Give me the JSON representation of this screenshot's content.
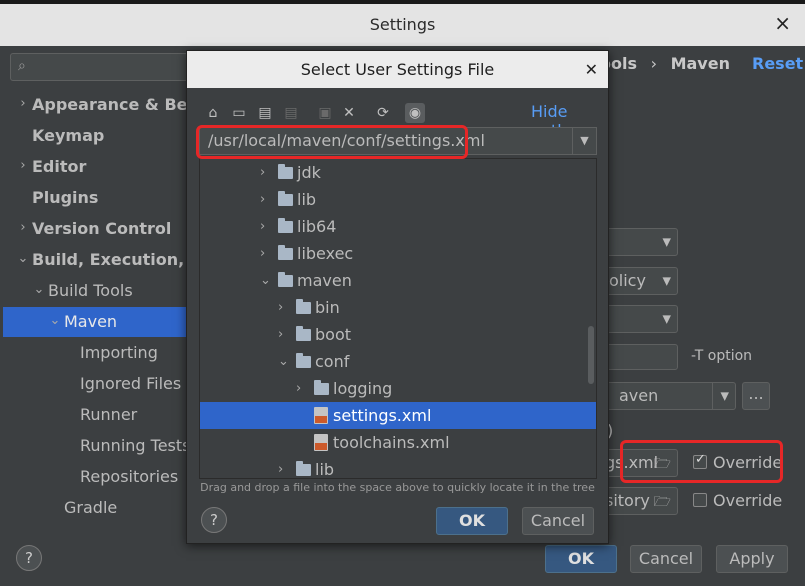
{
  "window": {
    "title": "Settings"
  },
  "sidebar": {
    "items": [
      {
        "label": "Appearance & Behavior",
        "bold": true,
        "arrow": "›"
      },
      {
        "label": "Keymap",
        "bold": true,
        "arrow": ""
      },
      {
        "label": "Editor",
        "bold": true,
        "arrow": "›"
      },
      {
        "label": "Plugins",
        "bold": true,
        "arrow": ""
      },
      {
        "label": "Version Control",
        "bold": true,
        "arrow": "›"
      },
      {
        "label": "Build, Execution, Deployment",
        "bold": true,
        "arrow": "⌄"
      },
      {
        "label": "Build Tools",
        "bold": false,
        "arrow": "⌄"
      },
      {
        "label": "Maven",
        "bold": false,
        "arrow": "⌄"
      },
      {
        "label": "Importing",
        "bold": false,
        "arrow": ""
      },
      {
        "label": "Ignored Files",
        "bold": false,
        "arrow": ""
      },
      {
        "label": "Runner",
        "bold": false,
        "arrow": ""
      },
      {
        "label": "Running Tests",
        "bold": false,
        "arrow": ""
      },
      {
        "label": "Repositories",
        "bold": false,
        "arrow": ""
      },
      {
        "label": "Gradle",
        "bold": false,
        "arrow": ""
      }
    ]
  },
  "breadcrumb": {
    "part1": "ools",
    "sep": "›",
    "part2": "Maven",
    "reset": "Reset"
  },
  "right": {
    "policy_fragment": "olicy",
    "t_option": "-T option",
    "maven_home_fragment": "aven",
    "more_button": "...",
    "settings_file_fragment": "gs.xml",
    "local_repo_fragment": "sitory",
    "override1": "Override",
    "override2": "Override",
    "paren_fragment": ")"
  },
  "dialog": {
    "title": "Select User Settings File",
    "hide_path": "Hide path",
    "path": "/usr/local/maven/conf/settings.xml",
    "tree": [
      {
        "label": "jdk",
        "type": "folder",
        "depth": 0,
        "arrow": "›"
      },
      {
        "label": "lib",
        "type": "folder",
        "depth": 0,
        "arrow": "›"
      },
      {
        "label": "lib64",
        "type": "folder",
        "depth": 0,
        "arrow": "›"
      },
      {
        "label": "libexec",
        "type": "folder",
        "depth": 0,
        "arrow": "›"
      },
      {
        "label": "maven",
        "type": "folder",
        "depth": 0,
        "arrow": "⌄"
      },
      {
        "label": "bin",
        "type": "folder",
        "depth": 1,
        "arrow": "›"
      },
      {
        "label": "boot",
        "type": "folder",
        "depth": 1,
        "arrow": "›"
      },
      {
        "label": "conf",
        "type": "folder",
        "depth": 1,
        "arrow": "⌄"
      },
      {
        "label": "logging",
        "type": "folder",
        "depth": 2,
        "arrow": "›"
      },
      {
        "label": "settings.xml",
        "type": "xml",
        "depth": 2,
        "arrow": ""
      },
      {
        "label": "toolchains.xml",
        "type": "xml",
        "depth": 2,
        "arrow": ""
      },
      {
        "label": "lib",
        "type": "folder",
        "depth": 1,
        "arrow": "›"
      }
    ],
    "hint": "Drag and drop a file into the space above to quickly locate it in the tree",
    "ok": "OK",
    "cancel": "Cancel"
  },
  "footer": {
    "ok": "OK",
    "cancel": "Cancel",
    "apply": "Apply",
    "help": "?"
  },
  "colors": {
    "selection": "#2f65ca",
    "link": "#589df6",
    "highlight": "#e62727"
  }
}
